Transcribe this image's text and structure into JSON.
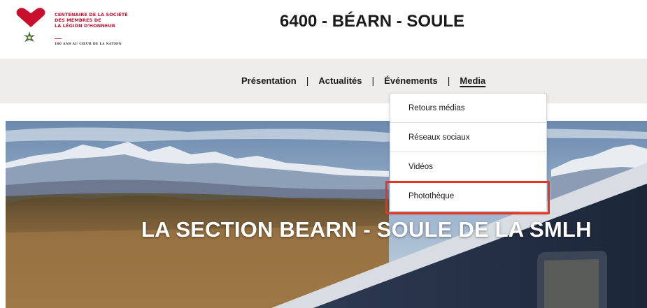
{
  "header": {
    "logo": {
      "lines": [
        "CENTENAIRE DE LA SOCIÉTÉ",
        "DES MEMBRES DE",
        "LA LÉGION D'HONNEUR"
      ],
      "tagline": "100 ANS AU CŒUR DE LA NATION",
      "icon": "legion-honneur-heart-icon",
      "color": "#c8102e"
    },
    "title": "6400 - BÉARN - SOULE"
  },
  "nav": {
    "items": [
      {
        "label": "Présentation"
      },
      {
        "label": "Actualités"
      },
      {
        "label": "Événements"
      },
      {
        "label": "Media"
      }
    ],
    "separator": "|",
    "active": "Media"
  },
  "dropdown": {
    "items": [
      {
        "label": "Retours médias"
      },
      {
        "label": "Réseaux sociaux"
      },
      {
        "label": "Vidéos"
      },
      {
        "label": "Photothèque"
      }
    ],
    "highlighted": "Photothèque",
    "highlight_color": "#e8341c"
  },
  "hero": {
    "heading": "LA SECTION BEARN - SOULE DE LA SMLH"
  }
}
